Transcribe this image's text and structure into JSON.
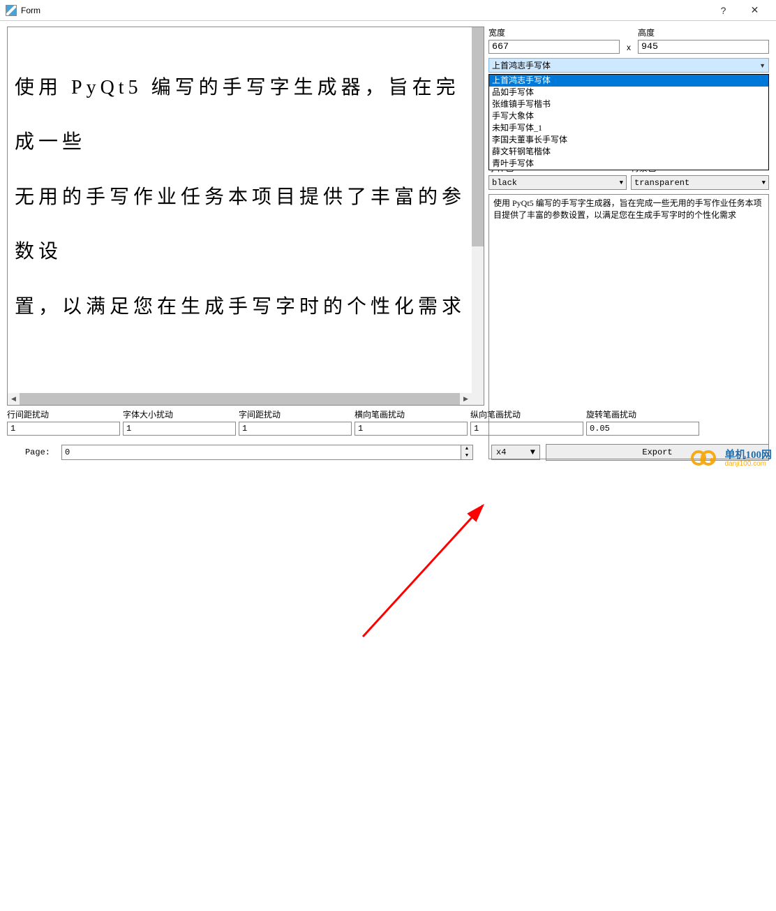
{
  "titlebar": {
    "title": "Form",
    "help": "?",
    "close": "✕"
  },
  "preview": {
    "text": "使用 PyQt5 编写的手写字生成器，旨在完成一些\n无用的手写作业任务本项目提供了丰富的参数设\n置，以满足您在生成手写字时的个性化需求"
  },
  "perturb": {
    "items": [
      {
        "label": "行间距扰动",
        "value": "1"
      },
      {
        "label": "字体大小扰动",
        "value": "1"
      },
      {
        "label": "字间距扰动",
        "value": "1"
      },
      {
        "label": "横向笔画扰动",
        "value": "1"
      },
      {
        "label": "纵向笔画扰动",
        "value": "1"
      },
      {
        "label": "旋转笔画扰动",
        "value": "0.05"
      }
    ]
  },
  "dims": {
    "width_label": "宽度",
    "width_value": "667",
    "sep": "x",
    "height_label": "高度",
    "height_value": "945"
  },
  "font_combo": {
    "selected": "上首鸿志手写体"
  },
  "font_options": [
    "上首鸿志手写体",
    "品如手写体",
    "张维镇手写楷书",
    "手写大象体",
    "未知手写体_1",
    "李国夫董事长手写体",
    "薛文轩钢笔楷体",
    "青叶手写体"
  ],
  "colors": {
    "font_label": "字体色",
    "font_value": "black",
    "bg_label": "背景色",
    "bg_value": "transparent"
  },
  "desc": {
    "text": "使用 PyQt5 编写的手写字生成器，旨在完成一些无用的手写作业任务本项目提供了丰富的参数设置，以满足您在生成手写字时的个性化需求"
  },
  "bottom": {
    "page_label": "Page:",
    "page_value": "0",
    "scale": "x4",
    "export": "Export"
  },
  "watermark": {
    "cn": "单机100网",
    "en": "danji100.com"
  }
}
